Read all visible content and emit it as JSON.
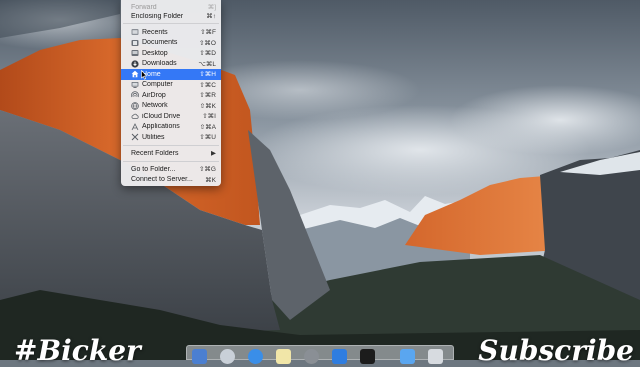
{
  "colors": {
    "menu_highlight": "#3478f6",
    "menu_bg": "#ececee"
  },
  "go_menu": {
    "items": [
      {
        "label": "Forward",
        "shortcut": "⌘]",
        "icon": "",
        "state": "disabled"
      },
      {
        "label": "Enclosing Folder",
        "shortcut": "⌘↑",
        "icon": ""
      },
      {
        "label": "Recents",
        "shortcut": "⇧⌘F",
        "icon": "recents-icon"
      },
      {
        "label": "Documents",
        "shortcut": "⇧⌘O",
        "icon": "documents-icon"
      },
      {
        "label": "Desktop",
        "shortcut": "⇧⌘D",
        "icon": "desktop-icon"
      },
      {
        "label": "Downloads",
        "shortcut": "⌥⌘L",
        "icon": "downloads-icon"
      },
      {
        "label": "Home",
        "shortcut": "⇧⌘H",
        "icon": "home-icon",
        "state": "highlighted"
      },
      {
        "label": "Computer",
        "shortcut": "⇧⌘C",
        "icon": "computer-icon"
      },
      {
        "label": "AirDrop",
        "shortcut": "⇧⌘R",
        "icon": "airdrop-icon"
      },
      {
        "label": "Network",
        "shortcut": "⇧⌘K",
        "icon": "network-icon"
      },
      {
        "label": "iCloud Drive",
        "shortcut": "⇧⌘I",
        "icon": "icloud-icon"
      },
      {
        "label": "Applications",
        "shortcut": "⇧⌘A",
        "icon": "applications-icon"
      },
      {
        "label": "Utilities",
        "shortcut": "⇧⌘U",
        "icon": "utilities-icon"
      },
      {
        "label": "Recent Folders",
        "shortcut": "▶",
        "icon": "",
        "submenu": true
      },
      {
        "label": "Go to Folder...",
        "shortcut": "⇧⌘G",
        "icon": ""
      },
      {
        "label": "Connect to Server...",
        "shortcut": "⌘K",
        "icon": ""
      }
    ]
  },
  "watermark": {
    "left_text": "#Bicker",
    "right_text": "Subscribe"
  },
  "dock": {
    "icons": [
      "launchpad-icon",
      "safari-icon",
      "system-preferences-icon",
      "notes-icon",
      "disk-utility-icon",
      "xcode-icon",
      "terminal-icon",
      "preview-icon",
      "trash-icon"
    ]
  }
}
